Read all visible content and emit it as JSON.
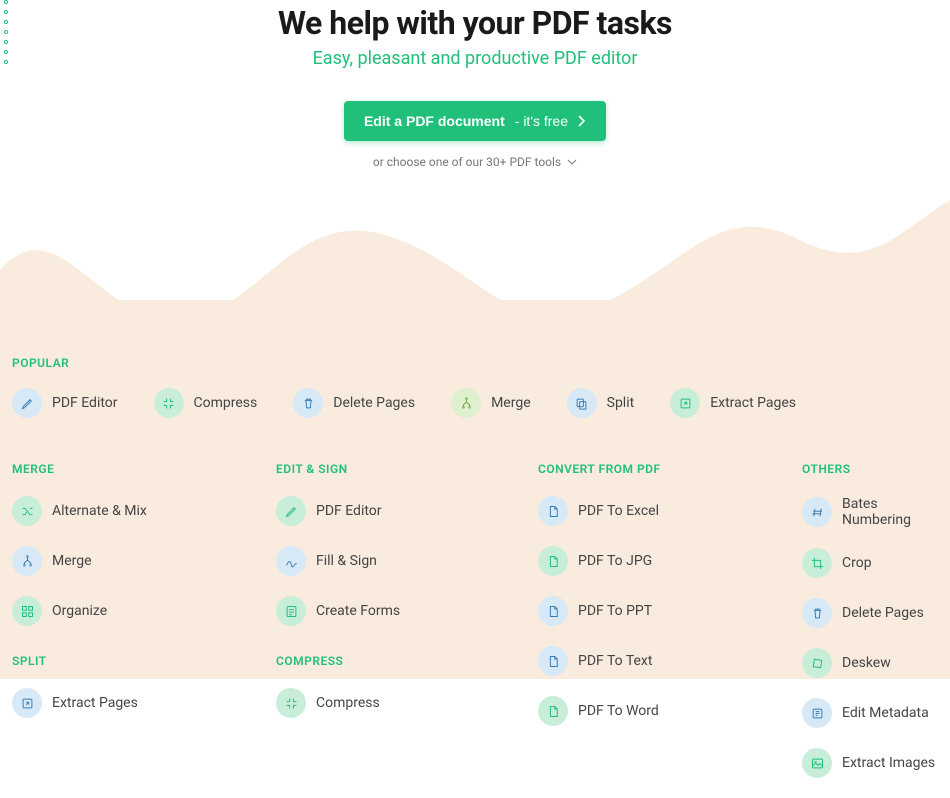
{
  "hero": {
    "title": "We help with your PDF tasks",
    "subtitle": "Easy, pleasant and productive PDF editor",
    "cta_bold": "Edit a PDF document",
    "cta_suffix": " - it's free",
    "alt_text": "or choose one of our 30+ PDF tools"
  },
  "sections": {
    "popular": {
      "label": "POPULAR",
      "items": [
        {
          "name": "pdf-editor",
          "label": "PDF Editor",
          "icon": "pencil",
          "tone": "blue"
        },
        {
          "name": "compress",
          "label": "Compress",
          "icon": "compress",
          "tone": "green"
        },
        {
          "name": "delete-pages",
          "label": "Delete Pages",
          "icon": "trash",
          "tone": "blue"
        },
        {
          "name": "merge",
          "label": "Merge",
          "icon": "tree",
          "tone": "lime"
        },
        {
          "name": "split",
          "label": "Split",
          "icon": "copy",
          "tone": "blue"
        },
        {
          "name": "extract-pages",
          "label": "Extract Pages",
          "icon": "extract",
          "tone": "green"
        }
      ]
    },
    "merge": {
      "label": "MERGE",
      "items": [
        {
          "name": "alternate-mix",
          "label": "Alternate & Mix",
          "icon": "shuffle",
          "tone": "green"
        },
        {
          "name": "merge",
          "label": "Merge",
          "icon": "tree",
          "tone": "blue"
        },
        {
          "name": "organize",
          "label": "Organize",
          "icon": "grid",
          "tone": "green"
        }
      ]
    },
    "split": {
      "label": "SPLIT",
      "items": [
        {
          "name": "extract-pages",
          "label": "Extract Pages",
          "icon": "extract",
          "tone": "blue"
        }
      ]
    },
    "edit_sign": {
      "label": "EDIT & SIGN",
      "items": [
        {
          "name": "pdf-editor",
          "label": "PDF Editor",
          "icon": "pencil",
          "tone": "green"
        },
        {
          "name": "fill-sign",
          "label": "Fill & Sign",
          "icon": "sign",
          "tone": "blue"
        },
        {
          "name": "create-forms",
          "label": "Create Forms",
          "icon": "form",
          "tone": "green"
        }
      ]
    },
    "compress": {
      "label": "COMPRESS",
      "items": [
        {
          "name": "compress",
          "label": "Compress",
          "icon": "compress",
          "tone": "green"
        }
      ]
    },
    "convert_from": {
      "label": "CONVERT FROM PDF",
      "items": [
        {
          "name": "pdf-to-excel",
          "label": "PDF To Excel",
          "icon": "file",
          "tone": "blue"
        },
        {
          "name": "pdf-to-jpg",
          "label": "PDF To JPG",
          "icon": "file",
          "tone": "green"
        },
        {
          "name": "pdf-to-ppt",
          "label": "PDF To PPT",
          "icon": "file",
          "tone": "blue"
        },
        {
          "name": "pdf-to-text",
          "label": "PDF To Text",
          "icon": "file",
          "tone": "blue"
        },
        {
          "name": "pdf-to-word",
          "label": "PDF To Word",
          "icon": "file",
          "tone": "green"
        }
      ]
    },
    "others": {
      "label": "OTHERS",
      "items": [
        {
          "name": "bates-numbering",
          "label": "Bates Numbering",
          "icon": "number",
          "tone": "blue"
        },
        {
          "name": "crop",
          "label": "Crop",
          "icon": "crop",
          "tone": "green"
        },
        {
          "name": "delete-pages",
          "label": "Delete Pages",
          "icon": "trash",
          "tone": "blue"
        },
        {
          "name": "deskew",
          "label": "Deskew",
          "icon": "deskew",
          "tone": "green"
        },
        {
          "name": "edit-metadata",
          "label": "Edit Metadata",
          "icon": "meta",
          "tone": "blue"
        },
        {
          "name": "extract-images",
          "label": "Extract Images",
          "icon": "image",
          "tone": "green"
        }
      ]
    }
  }
}
